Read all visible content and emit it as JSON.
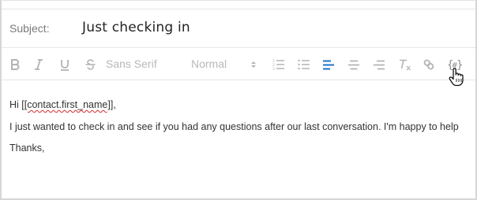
{
  "subject": {
    "label": "Subject:",
    "value": "Just checking in"
  },
  "toolbar": {
    "font_family": "Sans Serif",
    "font_size": "Normal",
    "icons": [
      "bold-icon",
      "italic-icon",
      "underline-icon",
      "strikethrough-icon",
      "font-family-select",
      "font-size-select",
      "ordered-list-icon",
      "bullet-list-icon",
      "align-left-icon",
      "align-center-icon",
      "align-right-icon",
      "clear-format-icon",
      "link-icon",
      "merge-field-icon"
    ],
    "active_color": "#1a73c8",
    "inactive_color": "#b3b3b3"
  },
  "body": {
    "greeting_prefix": "Hi ",
    "merge_tag": "[[contact.first_name]]",
    "greeting_suffix": ",",
    "line2": "I just wanted to check in and see if you had any questions after our last conversation. I'm happy to help",
    "line3": "Thanks,"
  }
}
